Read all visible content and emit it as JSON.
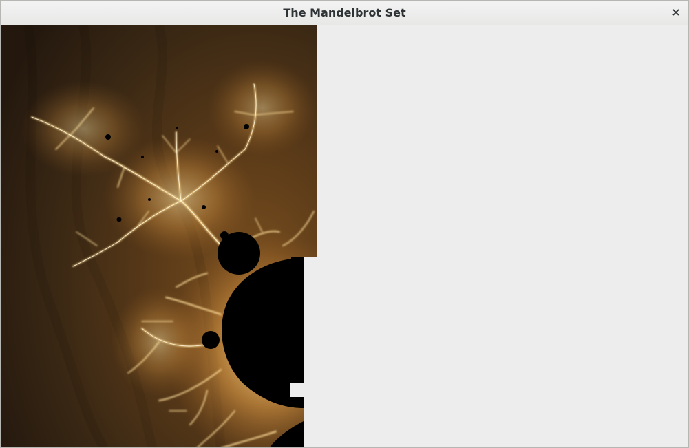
{
  "window": {
    "title": "The Mandelbrot Set",
    "close_glyph": "×"
  },
  "canvas": {
    "description_icon": "mandelbrot-render",
    "palette": {
      "set": "#000000",
      "deep_background": "#2a1d12",
      "mid_glow": "#8a5a22",
      "bright_glow": "#ffd27a",
      "filament": "#fff2c8",
      "empty_area": "#ededed"
    },
    "render_progress": 0.46
  }
}
